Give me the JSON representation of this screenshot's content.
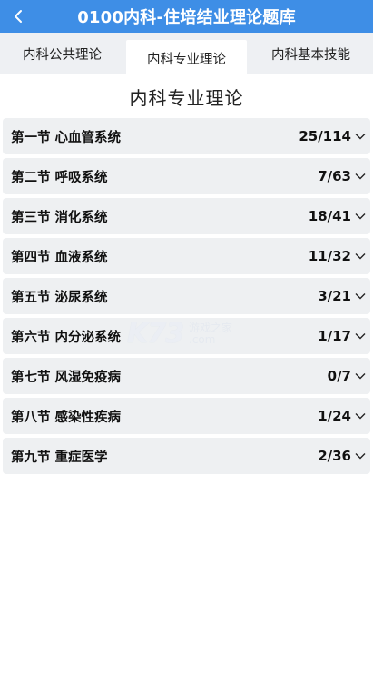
{
  "header": {
    "title": "0100内科-住培结业理论题库",
    "back_icon": "chevron-left-icon"
  },
  "tabs": [
    {
      "label": "内科公共理论",
      "active": false
    },
    {
      "label": "内科专业理论",
      "active": true
    },
    {
      "label": "内科基本技能",
      "active": false
    }
  ],
  "section_title": "内科专业理论",
  "chapters": [
    {
      "name": "第一节 心血管系统",
      "count": "25/114"
    },
    {
      "name": "第二节 呼吸系统",
      "count": "7/63"
    },
    {
      "name": "第三节 消化系统",
      "count": "18/41"
    },
    {
      "name": "第四节 血液系统",
      "count": "11/32"
    },
    {
      "name": "第五节 泌尿系统",
      "count": "3/21"
    },
    {
      "name": "第六节 内分泌系统",
      "count": "1/17"
    },
    {
      "name": "第七节 风湿免疫病",
      "count": "0/7"
    },
    {
      "name": "第八节 感染性疾病",
      "count": "1/24"
    },
    {
      "name": "第九节 重症医学",
      "count": "2/36"
    }
  ],
  "watermark": {
    "logo": "K73",
    "line1": "游戏之家",
    "line2": ".com"
  },
  "colors": {
    "header_bg": "#3e8ee6",
    "tab_bar_bg": "#eef0f3",
    "row_bg": "#eef0f2"
  }
}
